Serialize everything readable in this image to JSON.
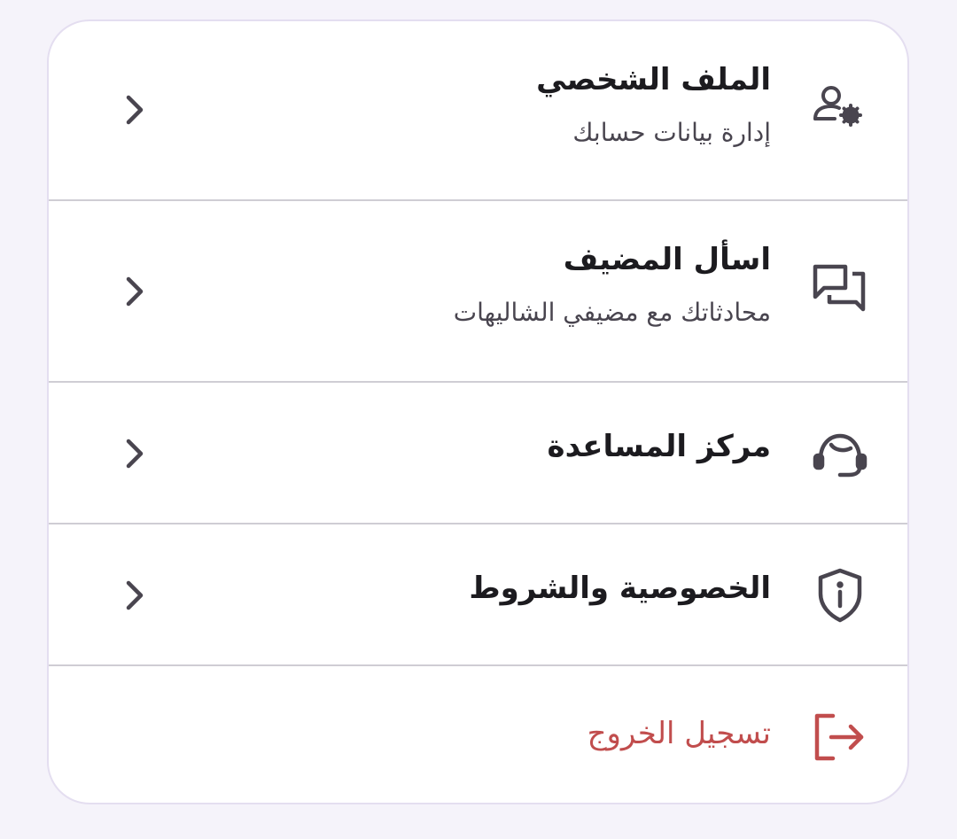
{
  "menu": {
    "items": [
      {
        "title": "الملف الشخصي",
        "subtitle": "إدارة بيانات حسابك",
        "icon": "user-gear-icon"
      },
      {
        "title": "اسأل المضيف",
        "subtitle": "محادثاتك مع مضيفي الشاليهات",
        "icon": "chat-bubbles-icon"
      },
      {
        "title": "مركز المساعدة",
        "icon": "headset-icon"
      },
      {
        "title": "الخصوصية والشروط",
        "icon": "shield-info-icon"
      }
    ],
    "logout": {
      "title": "تسجيل الخروج",
      "icon": "logout-icon"
    }
  },
  "colors": {
    "background": "#f5f3fa",
    "card": "#ffffff",
    "title": "#1c1b1f",
    "subtitle": "#49454f",
    "icon": "#49454f",
    "logout": "#c14d4d",
    "divider": "#cfcdd4"
  }
}
